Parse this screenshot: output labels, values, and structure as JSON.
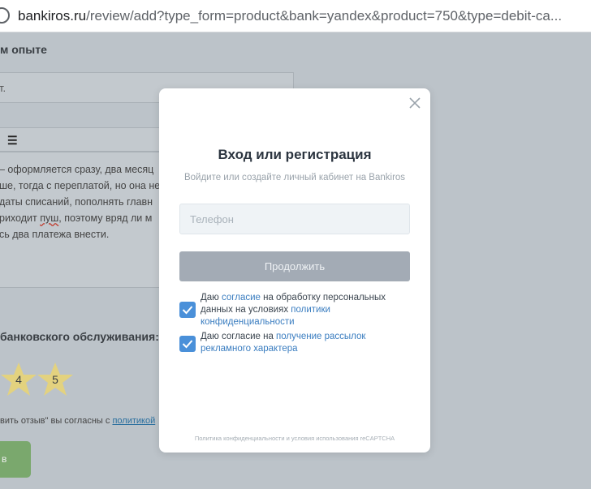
{
  "browser": {
    "url_host": "bankiros.ru",
    "url_rest": "/review/add?type_form=product&bank=yandex&product=750&type=debit-ca..."
  },
  "background": {
    "heading": "м опыте",
    "input_value": "т.",
    "editor_lines": [
      "– оформляется сразу, два месяц",
      "ше, тогда с переплатой, но она не",
      "даты списаний, пополнять главн",
      "риходит ",
      "сь два платежа внести."
    ],
    "editor_line4_underlined": "пуш",
    "editor_line4_tail": ", поэтому вряд ли м",
    "rating_title": "банковского обслуживания:",
    "stars": [
      "4",
      "5"
    ],
    "consent_text": "вить отзыв\" вы согласны с ",
    "consent_link": "политикой",
    "submit_label": "в"
  },
  "modal": {
    "title": "Вход или регистрация",
    "subtitle": "Войдите или создайте личный кабинет на Bankiros",
    "phone_placeholder": "Телефон",
    "phone_value": "",
    "continue_label": "Продолжить",
    "consent1_pre": "Даю ",
    "consent1_link1": "согласие",
    "consent1_mid": " на обработку персональных данных на условиях ",
    "consent1_link2": "политики конфиденциальности",
    "consent1_checked": true,
    "consent2_pre": "Даю согласие на ",
    "consent2_link": "получение рассылок рекламного характера",
    "consent2_checked": true,
    "recaptcha_note": "Политика конфиденциальности и условия использования reCAPTCHA"
  },
  "colors": {
    "overlay_bg": "#bcc3c9",
    "accent_blue": "#4a90d9",
    "link_blue": "#3a7dc0",
    "button_disabled": "#a3abb5",
    "bg_submit_green": "#7aa86d",
    "star_fill": "#e3d27f"
  },
  "icons": {
    "close": "close-icon",
    "check": "check-icon",
    "list": "bulleted-list-icon",
    "star": "star-icon"
  }
}
